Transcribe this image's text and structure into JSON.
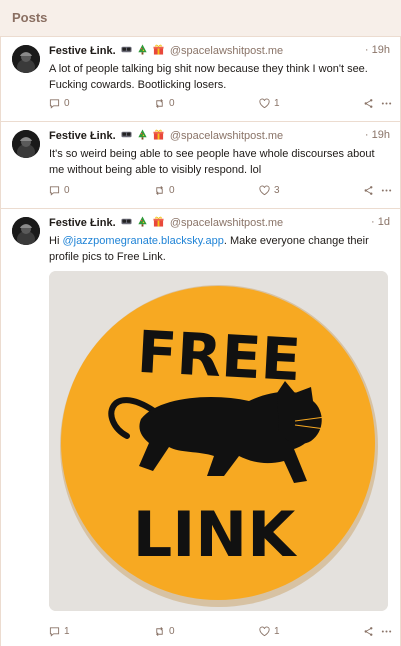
{
  "header": {
    "title": "Posts"
  },
  "posts": [
    {
      "author": "Festive Łink.",
      "emojis": [
        "glasses",
        "christmas-tree",
        "gift"
      ],
      "handle": "@spacelawshitpost.me",
      "time": "· 19h",
      "text": "A lot of people talking big shit now because they think I won't see. Fucking cowards. Bootlicking losers.",
      "replies": "0",
      "reposts": "0",
      "likes": "1"
    },
    {
      "author": "Festive Łink.",
      "emojis": [
        "glasses",
        "christmas-tree",
        "gift"
      ],
      "handle": "@spacelawshitpost.me",
      "time": "· 19h",
      "text": "It's so weird being able to see people have whole discourses about me without being able to visibly respond. lol",
      "replies": "0",
      "reposts": "0",
      "likes": "3"
    },
    {
      "author": "Festive Łink.",
      "emojis": [
        "glasses",
        "christmas-tree",
        "gift"
      ],
      "handle": "@spacelawshitpost.me",
      "time": "· 1d",
      "text_prefix": "Hi ",
      "mention": "@jazzpomegranate.blacksky.app",
      "text_suffix": ". Make everyone change their profile pics to Free Link.",
      "image": {
        "line1": "FREE",
        "line2": "LINK",
        "button_color": "#f7a922"
      },
      "replies": "1",
      "reposts": "0",
      "likes": "1"
    }
  ],
  "colors": {
    "accent_link": "#1f83d6",
    "muted": "#8a7468",
    "background": "#f7efe9"
  }
}
